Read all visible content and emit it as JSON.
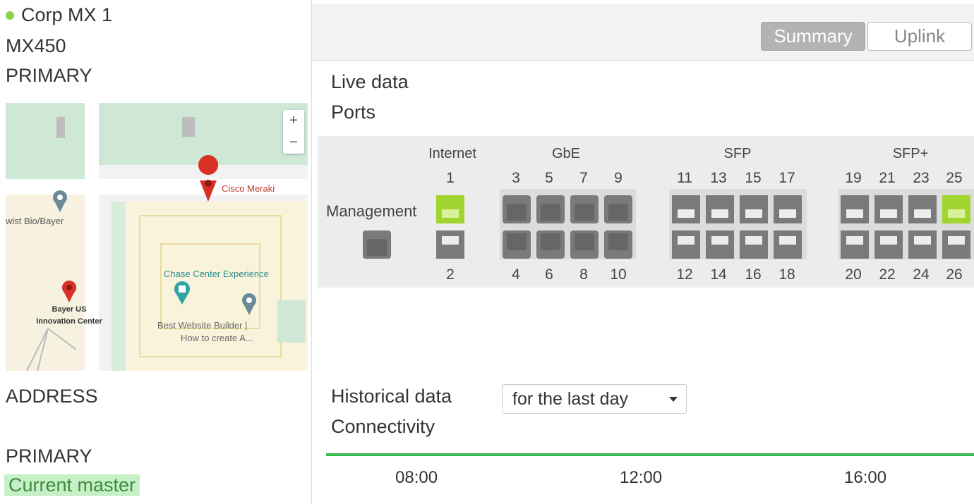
{
  "device": {
    "name": "Corp MX 1",
    "model": "MX450",
    "role": "PRIMARY",
    "status_color": "#8fd14f"
  },
  "map": {
    "zoom_in": "+",
    "zoom_out": "−",
    "places": {
      "cisco_meraki": "Cisco Meraki",
      "twist_bio": "wist Bio/Bayer",
      "chase_center": "Chase Center Experience",
      "bayer_line1": "Bayer US",
      "bayer_line2": "Innovation Center",
      "builder_line1": "Best Website Builder |",
      "builder_line2": "How to create A..."
    }
  },
  "left_footer": {
    "address_label": "ADDRESS",
    "primary_label": "PRIMARY",
    "current_master": "Current master"
  },
  "tabs": {
    "summary": "Summary",
    "uplink": "Uplink",
    "active": "Summary"
  },
  "live": {
    "section_label": "Live data",
    "ports_label": "Ports"
  },
  "ports": {
    "management_label": "Management",
    "groups": {
      "internet": "Internet",
      "gbe": "GbE",
      "sfp": "SFP",
      "sfp_plus": "SFP+"
    },
    "numbers": {
      "p1": "1",
      "p2": "2",
      "p3": "3",
      "p4": "4",
      "p5": "5",
      "p6": "6",
      "p7": "7",
      "p8": "8",
      "p9": "9",
      "p10": "10",
      "p11": "11",
      "p12": "12",
      "p13": "13",
      "p14": "14",
      "p15": "15",
      "p16": "16",
      "p17": "17",
      "p18": "18",
      "p19": "19",
      "p20": "20",
      "p21": "21",
      "p22": "22",
      "p23": "23",
      "p24": "24",
      "p25": "25",
      "p26": "26"
    },
    "active_ports": [
      "1",
      "25"
    ],
    "active_color": "#9fd52e",
    "inactive_color": "#7a7a7a"
  },
  "historical": {
    "section_label": "Historical data",
    "range_select": "for the last day",
    "connectivity_label": "Connectivity",
    "connectivity_color": "#3cb94f",
    "ticks": [
      "08:00",
      "12:00",
      "16:00"
    ]
  }
}
